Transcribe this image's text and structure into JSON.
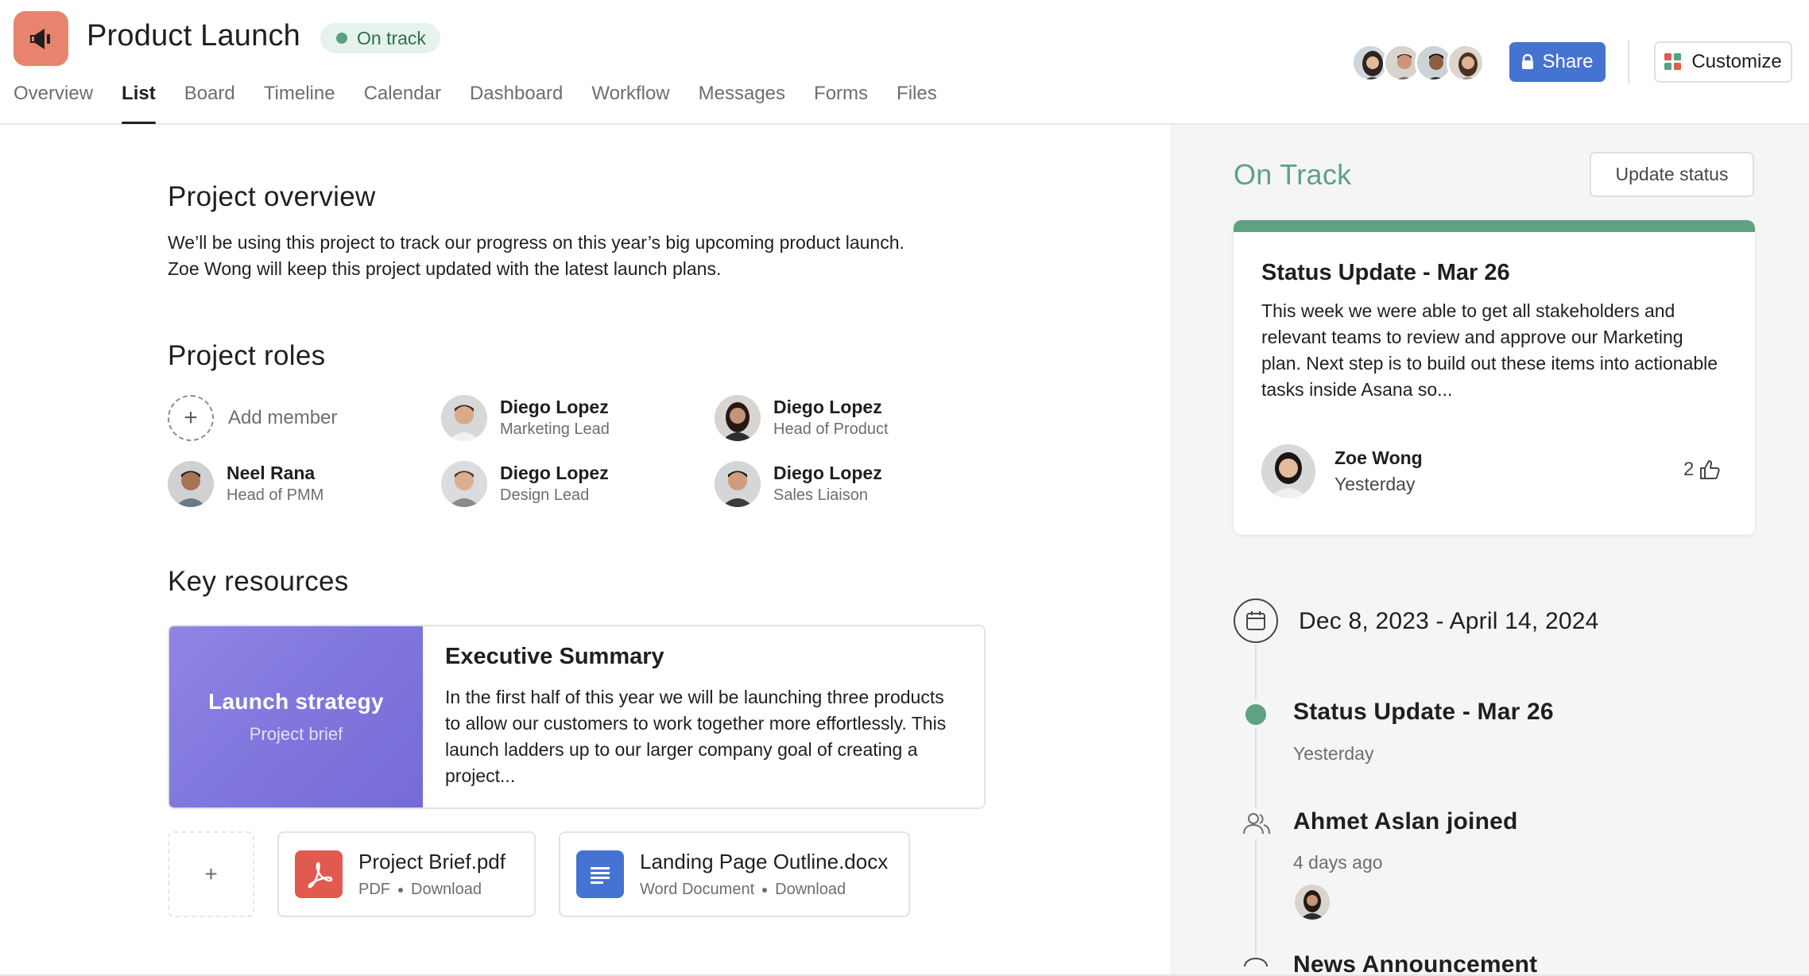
{
  "header": {
    "title": "Product Launch",
    "status": "On track",
    "tabs": [
      "Overview",
      "List",
      "Board",
      "Timeline",
      "Calendar",
      "Dashboard",
      "Workflow",
      "Messages",
      "Forms",
      "Files"
    ],
    "active_tab": "List",
    "share_label": "Share",
    "customize_label": "Customize"
  },
  "overview": {
    "heading": "Project overview",
    "line1": "We’ll be using this project to track our progress on this year’s big upcoming product launch.",
    "line2": "Zoe Wong will keep this project updated with the latest launch plans."
  },
  "roles": {
    "heading": "Project roles",
    "add_label": "Add member",
    "members": [
      {
        "name": "Diego Lopez",
        "role": "Marketing Lead"
      },
      {
        "name": "Diego Lopez",
        "role": "Head of Product"
      },
      {
        "name": "Neel Rana",
        "role": "Head of PMM"
      },
      {
        "name": "Diego Lopez",
        "role": "Design Lead"
      },
      {
        "name": "Diego Lopez",
        "role": "Sales Liaison"
      }
    ]
  },
  "resources": {
    "heading": "Key resources",
    "brief": {
      "thumb_title": "Launch strategy",
      "thumb_sub": "Project brief",
      "title": "Executive Summary",
      "text": "In the first half of this year we will be launching three products to allow our customers to work together more effortlessly. This launch ladders up to our larger company goal of creating a project..."
    },
    "add_symbol": "+",
    "files": [
      {
        "name": "Project Brief.pdf",
        "type": "PDF",
        "action": "Download"
      },
      {
        "name": "Landing Page Outline.docx",
        "type": "Word Document",
        "action": "Download"
      }
    ]
  },
  "panel": {
    "status": "On Track",
    "update_btn": "Update status",
    "card": {
      "title": "Status Update - Mar 26",
      "text": "This week we were able to get all stakeholders and relevant teams to review and approve our Marketing plan. Next step is to build out these items into actionable tasks inside Asana so...",
      "author": "Zoe Wong",
      "time": "Yesterday",
      "likes": "2"
    },
    "date_range": "Dec 8, 2023 - April 14, 2024",
    "timeline": [
      {
        "title": "Status Update - Mar 26",
        "sub": "Yesterday"
      },
      {
        "title": "Ahmet Aslan joined",
        "sub": "4 days ago"
      },
      {
        "title": "News Announcement",
        "sub": ""
      }
    ]
  },
  "colors": {
    "accent": "#4573d2",
    "on_track_green": "#5da283",
    "app_icon": "#e7836e",
    "brief_purple": "#8178de",
    "pdf_red": "#e05a4f",
    "doc_blue": "#4573d2"
  }
}
